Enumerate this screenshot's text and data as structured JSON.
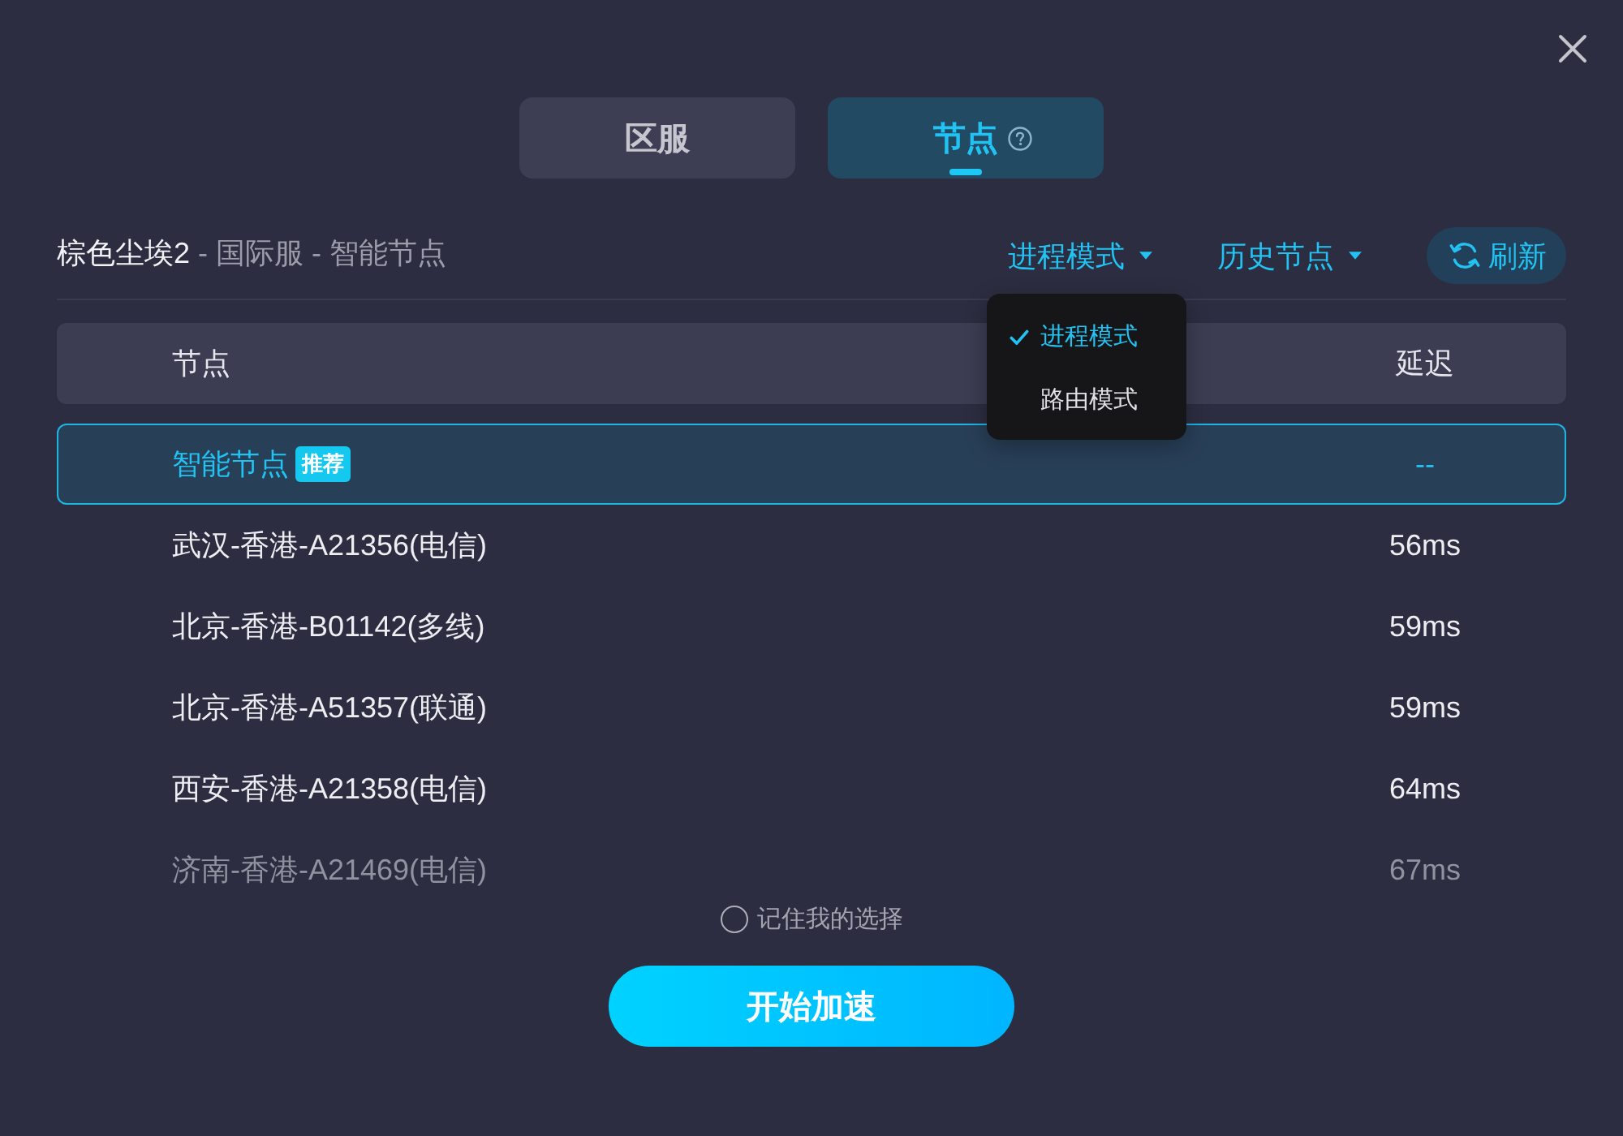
{
  "tabs": [
    {
      "label": "区服",
      "selected": false,
      "help_icon": false
    },
    {
      "label": "节点",
      "selected": true,
      "help_icon": true
    }
  ],
  "breadcrumb": {
    "title": "棕色尘埃2",
    "path": "- 国际服 - 智能节点"
  },
  "menus": [
    {
      "label": "进程模式",
      "expanded": true,
      "options": [
        {
          "label": "进程模式",
          "selected": true
        },
        {
          "label": "路由模式",
          "selected": false
        }
      ]
    },
    {
      "label": "历史节点"
    }
  ],
  "refresh_button": {
    "label": "刷新"
  },
  "table": {
    "columns": [
      "节点",
      "延迟"
    ],
    "rows": [
      {
        "name": "智能节点",
        "badge": "推荐",
        "latency": "--",
        "selected": true
      },
      {
        "name": "武汉-香港-A21356(电信)",
        "latency": "56ms",
        "selected": false
      },
      {
        "name": "北京-香港-B01142(多线)",
        "latency": "59ms",
        "selected": false
      },
      {
        "name": "北京-香港-A51357(联通)",
        "latency": "59ms",
        "selected": false
      },
      {
        "name": "西安-香港-A21358(电信)",
        "latency": "64ms",
        "selected": false
      },
      {
        "name": "济南-香港-A21469(电信)",
        "latency": "67ms",
        "selected": false
      }
    ]
  },
  "remember_choice": {
    "label": "记住我的选择",
    "checked": false
  },
  "start_button": {
    "label": "开始加速"
  }
}
